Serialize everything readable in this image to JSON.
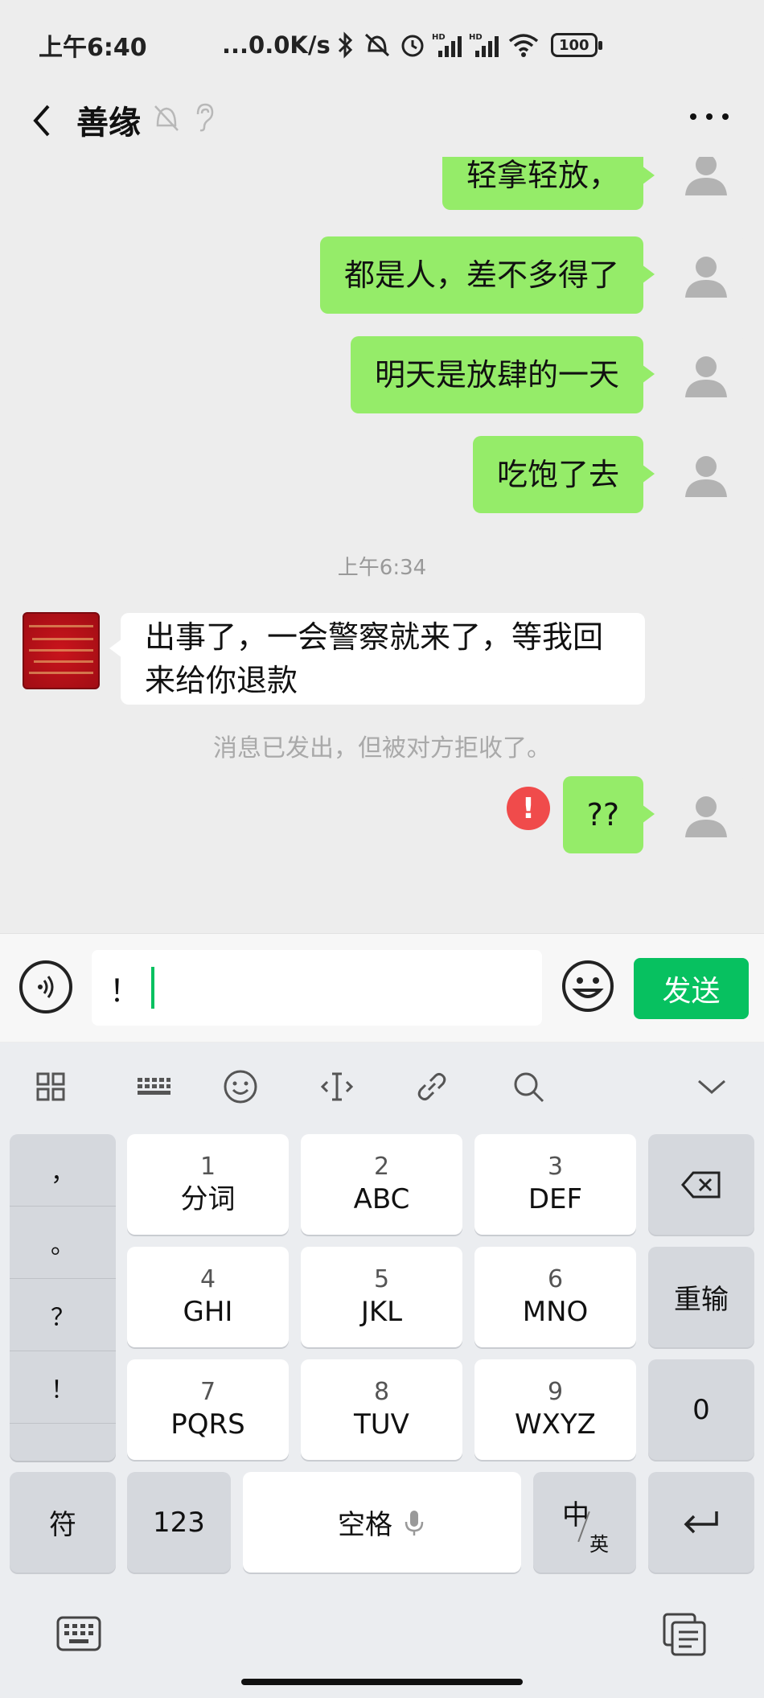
{
  "status_bar": {
    "time": "上午6:40",
    "network_speed": "...0.0K/s",
    "battery": "100",
    "icons": [
      "bluetooth-icon",
      "mute-icon",
      "alarm-icon",
      "hd-signal-icon",
      "hd-signal-icon",
      "wifi-icon",
      "battery-icon"
    ]
  },
  "header": {
    "title": "善缘",
    "back_icon": "chevron-left-icon",
    "mute_icon": "bell-off-icon",
    "earpiece_icon": "ear-icon",
    "more_icon": "more-dots-icon"
  },
  "messages": [
    {
      "from": "me",
      "text": "轻拿轻放，"
    },
    {
      "from": "me",
      "text": "都是人，差不多得了"
    },
    {
      "from": "me",
      "text": "明天是放肆的一天"
    },
    {
      "from": "me",
      "text": "吃饱了去"
    },
    {
      "type": "timestamp",
      "text": "上午6:34"
    },
    {
      "from": "them",
      "text": "出事了，一会警察就来了，等我回来给你退款"
    },
    {
      "type": "system",
      "text": "消息已发出，但被对方拒收了。"
    },
    {
      "from": "me",
      "text": "??",
      "error": true,
      "error_symbol": "!"
    }
  ],
  "input_bar": {
    "value": "！",
    "send_label": "发送",
    "voice_icon": "voice-icon",
    "emoji_icon": "emoji-icon"
  },
  "keyboard": {
    "toolbar_icons": [
      "grid-icon",
      "keyboard-icon",
      "emoji-icon",
      "cursor-icon",
      "link-icon",
      "search-icon",
      "chevron-down-icon"
    ],
    "punctuation": [
      "，",
      "。",
      "？",
      "！"
    ],
    "keys": [
      {
        "num": "1",
        "letters": "分词"
      },
      {
        "num": "2",
        "letters": "ABC"
      },
      {
        "num": "3",
        "letters": "DEF"
      },
      {
        "num": "4",
        "letters": "GHI"
      },
      {
        "num": "5",
        "letters": "JKL"
      },
      {
        "num": "6",
        "letters": "MNO"
      },
      {
        "num": "7",
        "letters": "PQRS"
      },
      {
        "num": "8",
        "letters": "TUV"
      },
      {
        "num": "9",
        "letters": "WXYZ"
      }
    ],
    "reinput_label": "重输",
    "zero_label": "0",
    "symbol_label": "符",
    "numeric_label": "123",
    "space_label": "空格",
    "lang_main": "中",
    "lang_sub": "英",
    "bottom_left_icon": "keyboard-switch-icon",
    "bottom_right_icon": "clipboard-icon"
  },
  "colors": {
    "my_bubble": "#95ec69",
    "their_bubble": "#ffffff",
    "send_button": "#07c160",
    "error": "#f04b4b",
    "background": "#ededed"
  }
}
